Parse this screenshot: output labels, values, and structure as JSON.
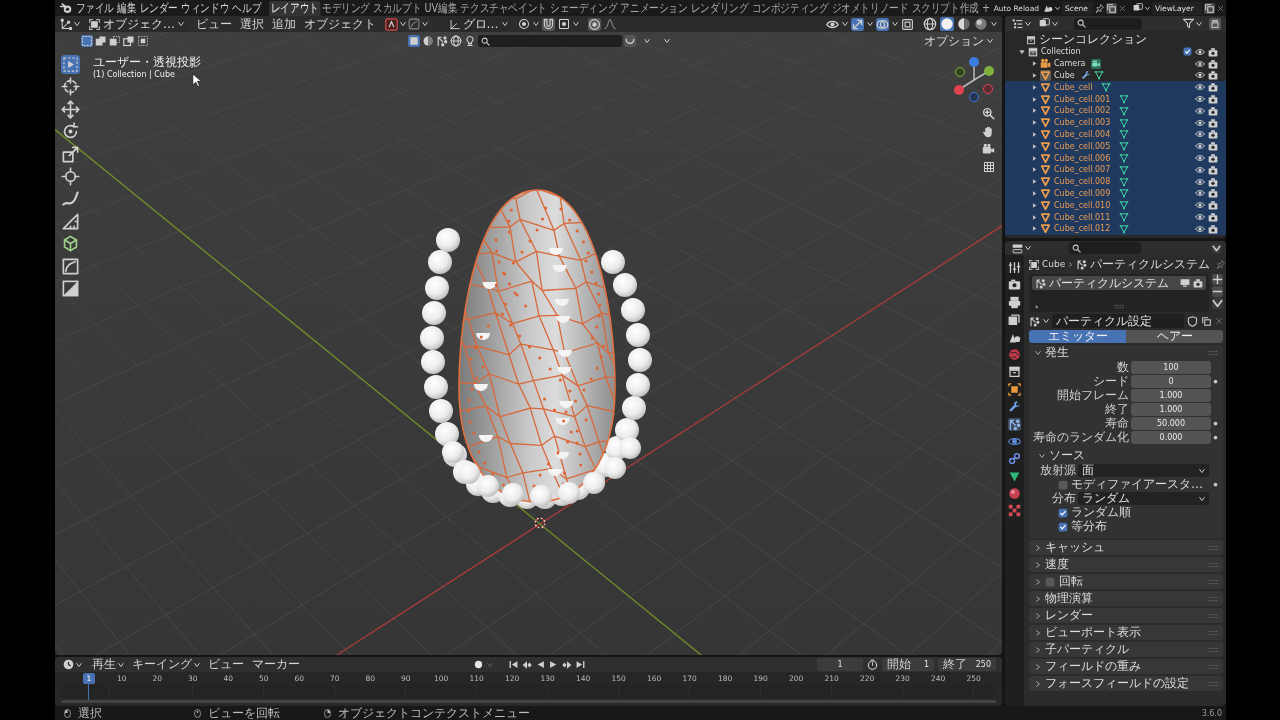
{
  "topbar": {
    "menus": [
      "ファイル",
      "編集",
      "レンダー",
      "ウィンドウ",
      "ヘルプ"
    ],
    "workspaces": [
      {
        "label": "レイアウト",
        "selected": true
      },
      {
        "label": "モデリング",
        "selected": false
      },
      {
        "label": "スカルプト",
        "selected": false
      },
      {
        "label": "UV編集",
        "selected": false
      },
      {
        "label": "テクスチャペイント",
        "selected": false
      },
      {
        "label": "シェーディング",
        "selected": false
      },
      {
        "label": "アニメーション",
        "selected": false
      },
      {
        "label": "レンダリング",
        "selected": false
      },
      {
        "label": "コンポジティング",
        "selected": false
      },
      {
        "label": "ジオメトリノード",
        "selected": false
      },
      {
        "label": "スクリプト作成",
        "selected": false
      }
    ],
    "add_workspace": "+",
    "auto_reload": "Auto Reload",
    "scene": "Scene",
    "view_layer": "ViewLayer"
  },
  "viewport": {
    "mode": "オブジェク…",
    "menus": [
      "ビュー",
      "選択",
      "追加",
      "オブジェクト"
    ],
    "orientation": "グロ…",
    "toggles": [
      {
        "kind": "gizmo",
        "on": true
      },
      {
        "kind": "overlay",
        "on": true
      },
      {
        "kind": "xray",
        "on": false
      }
    ],
    "shading": [
      {
        "kind": "wireframe",
        "selected": false
      },
      {
        "kind": "solid",
        "selected": true
      },
      {
        "kind": "material",
        "selected": false
      },
      {
        "kind": "rendered",
        "selected": false
      }
    ],
    "select_modes": [
      {
        "kind": "new",
        "selected": true
      },
      {
        "kind": "extend",
        "selected": false
      },
      {
        "kind": "subtract",
        "selected": false
      },
      {
        "kind": "difference",
        "selected": false
      },
      {
        "kind": "intersect",
        "selected": false
      }
    ],
    "filters": [
      {
        "kind": "square",
        "selected": true
      },
      {
        "kind": "sphere",
        "selected": false
      },
      {
        "kind": "particles",
        "selected": false
      },
      {
        "kind": "globe",
        "selected": false
      },
      {
        "kind": "lamp",
        "selected": false
      }
    ],
    "options": "オプション",
    "view_name": "ユーザー・透視投影",
    "context": "(1) Collection | Cube",
    "tools": [
      {
        "kind": "select",
        "selected": true
      },
      {
        "kind": "cursor",
        "selected": false
      },
      {
        "kind": "move",
        "selected": false
      },
      {
        "kind": "rotate",
        "selected": false
      },
      {
        "kind": "scale",
        "selected": false
      },
      {
        "kind": "transform",
        "selected": false
      },
      {
        "kind": "annotate",
        "selected": false
      },
      {
        "kind": "measure",
        "selected": false
      },
      {
        "kind": "add-cube",
        "selected": false
      },
      {
        "kind": "curve-box",
        "selected": false
      },
      {
        "kind": "diagonal-box",
        "selected": false
      }
    ]
  },
  "timeline": {
    "menus": [
      {
        "label": "再生",
        "dropdown": true
      },
      {
        "label": "キーイング",
        "dropdown": true
      },
      {
        "label": "ビュー",
        "dropdown": false
      },
      {
        "label": "マーカー",
        "dropdown": false
      }
    ],
    "current_frame": "1",
    "start_label": "開始",
    "start": "1",
    "end_label": "終了",
    "end": "250",
    "playhead": "1",
    "ticks": [
      "10",
      "20",
      "30",
      "40",
      "50",
      "60",
      "70",
      "80",
      "90",
      "100",
      "110",
      "120",
      "130",
      "140",
      "150",
      "160",
      "170",
      "180",
      "190",
      "200",
      "210",
      "220",
      "230",
      "240",
      "250"
    ]
  },
  "outliner": {
    "root": "シーンコレクション",
    "collections": [
      {
        "name": "Collection",
        "checked": true,
        "expanded": true,
        "visible": true,
        "renderable": true,
        "children": [
          {
            "name": "Camera",
            "kind": "camera",
            "modifier": false,
            "active": false,
            "selected": false,
            "expanded": false,
            "visible": true,
            "renderable": true
          },
          {
            "name": "Cube",
            "kind": "mesh",
            "modifier": true,
            "active": true,
            "selected": false,
            "expanded": false,
            "visible": true,
            "renderable": true
          },
          {
            "name": "Cube_cell",
            "kind": "mesh",
            "modifier": false,
            "active": false,
            "selected": true,
            "expanded": false,
            "visible": true,
            "renderable": true
          },
          {
            "name": "Cube_cell.001",
            "kind": "mesh",
            "modifier": false,
            "active": false,
            "selected": true,
            "expanded": false,
            "visible": true,
            "renderable": true
          },
          {
            "name": "Cube_cell.002",
            "kind": "mesh",
            "modifier": false,
            "active": false,
            "selected": true,
            "expanded": false,
            "visible": true,
            "renderable": true
          },
          {
            "name": "Cube_cell.003",
            "kind": "mesh",
            "modifier": false,
            "active": false,
            "selected": true,
            "expanded": false,
            "visible": true,
            "renderable": true
          },
          {
            "name": "Cube_cell.004",
            "kind": "mesh",
            "modifier": false,
            "active": false,
            "selected": true,
            "expanded": false,
            "visible": true,
            "renderable": true
          },
          {
            "name": "Cube_cell.005",
            "kind": "mesh",
            "modifier": false,
            "active": false,
            "selected": true,
            "expanded": false,
            "visible": true,
            "renderable": true
          },
          {
            "name": "Cube_cell.006",
            "kind": "mesh",
            "modifier": false,
            "active": false,
            "selected": true,
            "expanded": false,
            "visible": true,
            "renderable": true
          },
          {
            "name": "Cube_cell.007",
            "kind": "mesh",
            "modifier": false,
            "active": false,
            "selected": true,
            "expanded": false,
            "visible": true,
            "renderable": true
          },
          {
            "name": "Cube_cell.008",
            "kind": "mesh",
            "modifier": false,
            "active": false,
            "selected": true,
            "expanded": false,
            "visible": true,
            "renderable": true
          },
          {
            "name": "Cube_cell.009",
            "kind": "mesh",
            "modifier": false,
            "active": false,
            "selected": true,
            "expanded": false,
            "visible": true,
            "renderable": true
          },
          {
            "name": "Cube_cell.010",
            "kind": "mesh",
            "modifier": false,
            "active": false,
            "selected": true,
            "expanded": false,
            "visible": true,
            "renderable": true
          },
          {
            "name": "Cube_cell.011",
            "kind": "mesh",
            "modifier": false,
            "active": false,
            "selected": true,
            "expanded": false,
            "visible": true,
            "renderable": true
          },
          {
            "name": "Cube_cell.012",
            "kind": "mesh",
            "modifier": false,
            "active": false,
            "selected": true,
            "expanded": false,
            "visible": true,
            "renderable": true
          }
        ]
      }
    ]
  },
  "properties": {
    "tabs": [
      {
        "kind": "tool",
        "selected": false
      },
      {
        "kind": "render",
        "selected": false
      },
      {
        "kind": "output",
        "selected": false
      },
      {
        "kind": "view-layer",
        "selected": false
      },
      {
        "kind": "scene",
        "selected": false
      },
      {
        "kind": "world",
        "selected": false
      },
      {
        "kind": "collection",
        "selected": false
      },
      {
        "kind": "object",
        "selected": false
      },
      {
        "kind": "modifier",
        "selected": false
      },
      {
        "kind": "particles",
        "selected": true
      },
      {
        "kind": "physics",
        "selected": false
      },
      {
        "kind": "constraints",
        "selected": false
      },
      {
        "kind": "data",
        "selected": false
      },
      {
        "kind": "material",
        "selected": false
      },
      {
        "kind": "texture",
        "selected": false
      }
    ],
    "breadcrumb": [
      "Cube",
      "パーティクルシステム"
    ],
    "systems": [
      {
        "name": "パーティクルシステム",
        "selected": true
      }
    ],
    "settings": "パーティクル設定",
    "type_tabs": [
      {
        "label": "エミッター",
        "selected": true
      },
      {
        "label": "ヘアー",
        "selected": false
      }
    ],
    "panels": [
      {
        "kind": "plain",
        "title": "発生",
        "expanded": true,
        "fields": [
          {
            "label": "数",
            "value": "100",
            "keyframe_dot": false
          },
          {
            "label": "シード",
            "value": "0",
            "keyframe_dot": true
          },
          {
            "label": "開始フレーム",
            "value": "1.000",
            "keyframe_dot": false
          },
          {
            "label": "終了",
            "value": "1.000",
            "keyframe_dot": false
          },
          {
            "label": "寿命",
            "value": "50.000",
            "keyframe_dot": true
          },
          {
            "label": "寿命のランダム化",
            "value": "0.000",
            "keyframe_dot": true
          }
        ],
        "subpanels": [
          {
            "title": "ソース",
            "expanded": true,
            "rows": [
              {
                "kind": "dropdown",
                "label": "放射源",
                "value": "面"
              },
              {
                "kind": "checkbox",
                "label": "モディファイアースタ…",
                "checked": false,
                "keyframe_dot": true
              },
              {
                "kind": "dropdown",
                "label": "分布",
                "value": "ランダム"
              },
              {
                "kind": "checkbox",
                "label": "ランダム順",
                "checked": true,
                "keyframe_dot": false
              },
              {
                "kind": "checkbox",
                "label": "等分布",
                "checked": true,
                "keyframe_dot": false
              }
            ]
          }
        ]
      },
      {
        "kind": "plain",
        "title": "キャッシュ",
        "expanded": false
      },
      {
        "kind": "plain",
        "title": "速度",
        "expanded": false
      },
      {
        "kind": "toggle",
        "title": "回転",
        "expanded": false,
        "checked": false
      },
      {
        "kind": "plain",
        "title": "物理演算",
        "expanded": false
      },
      {
        "kind": "plain",
        "title": "レンダー",
        "expanded": false
      },
      {
        "kind": "plain",
        "title": "ビューポート表示",
        "expanded": false
      },
      {
        "kind": "plain",
        "title": "子パーティクル",
        "expanded": false
      },
      {
        "kind": "plain",
        "title": "フィールドの重み",
        "expanded": false
      },
      {
        "kind": "plain",
        "title": "フォースフィールドの設定",
        "expanded": false
      }
    ]
  },
  "status_bar": {
    "hints": [
      {
        "kind": "left",
        "label": "選択"
      },
      {
        "kind": "middle",
        "label": "ビューを回転"
      },
      {
        "kind": "right",
        "label": "オブジェクトコンテクストメニュー"
      }
    ],
    "version": "3.6.0"
  }
}
